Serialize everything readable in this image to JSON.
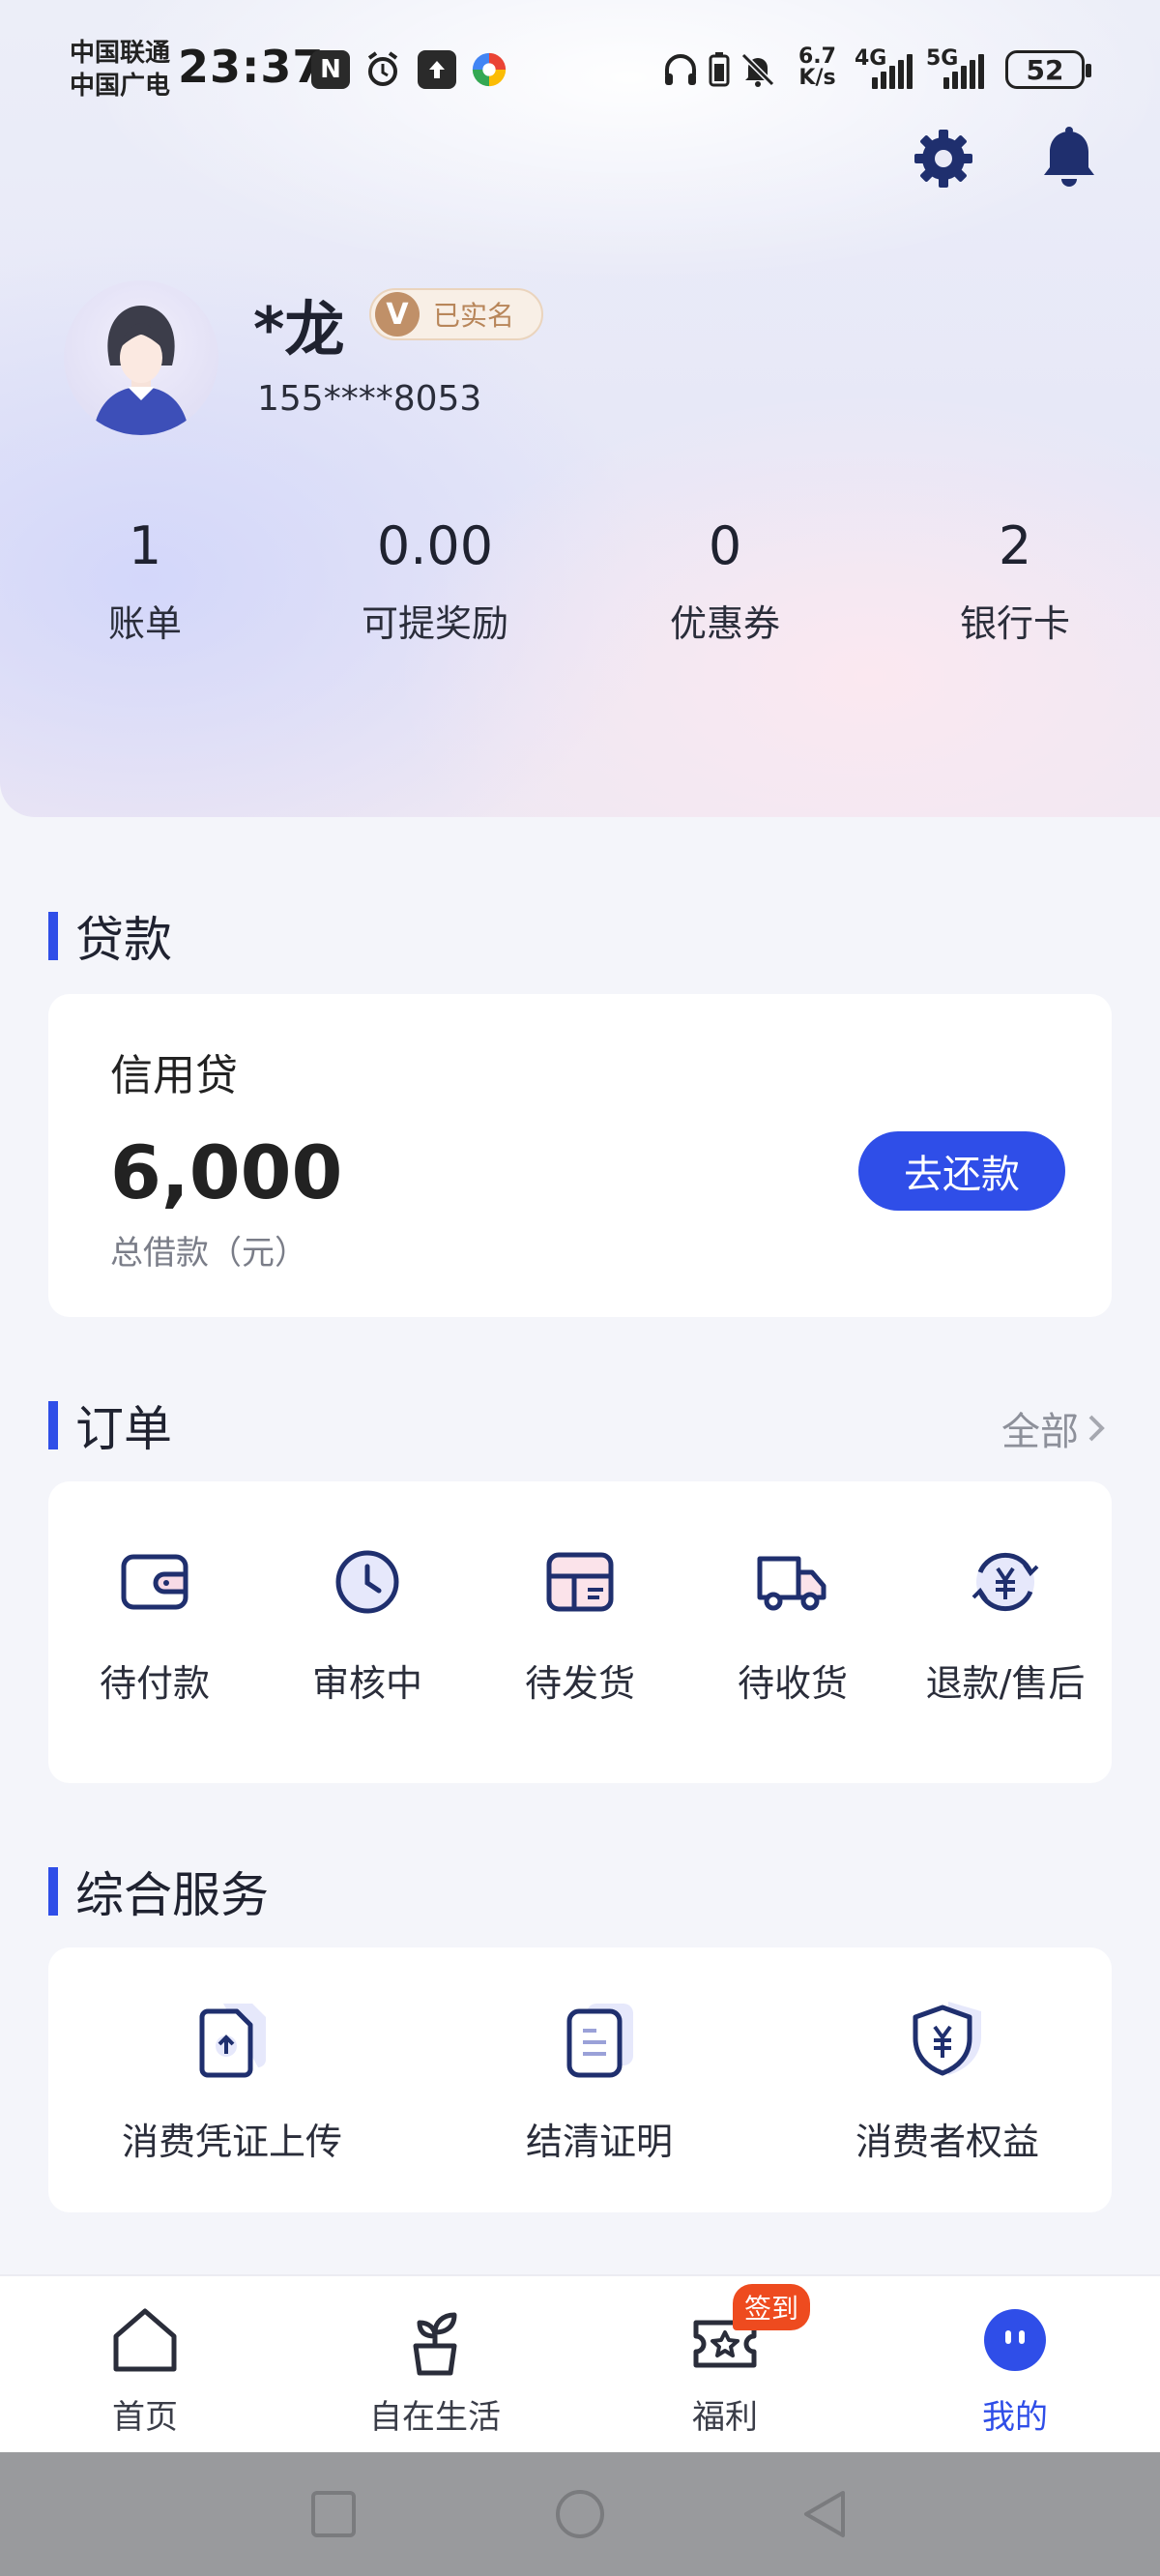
{
  "status_bar": {
    "carrier_1": "中国联通",
    "carrier_2": "中国广电",
    "time": "23:37",
    "net_speed_top": "6.7",
    "net_speed_bottom": "K/s",
    "sim1": "4G",
    "sim2": "5G",
    "battery": "52"
  },
  "profile": {
    "name": "*龙",
    "verified_badge": "V",
    "verified_label": "已实名",
    "phone": "155****8053"
  },
  "stats": [
    {
      "value": "1",
      "label": "账单"
    },
    {
      "value": "0.00",
      "label": "可提奖励"
    },
    {
      "value": "0",
      "label": "优惠券"
    },
    {
      "value": "2",
      "label": "银行卡"
    }
  ],
  "loan_section": {
    "title": "贷款",
    "product": "信用贷",
    "amount": "6,000",
    "amount_label": "总借款（元）",
    "repay_button": "去还款"
  },
  "order_section": {
    "title": "订单",
    "all_link": "全部",
    "items": [
      {
        "label": "待付款",
        "icon": "wallet-icon"
      },
      {
        "label": "审核中",
        "icon": "clock-icon"
      },
      {
        "label": "待发货",
        "icon": "package-icon"
      },
      {
        "label": "待收货",
        "icon": "truck-icon"
      },
      {
        "label": "退款/售后",
        "icon": "refund-icon"
      }
    ]
  },
  "service_section": {
    "title": "综合服务",
    "items": [
      {
        "label": "消费凭证上传",
        "icon": "upload-document-icon"
      },
      {
        "label": "结清证明",
        "icon": "document-icon"
      },
      {
        "label": "消费者权益",
        "icon": "shield-yen-icon"
      }
    ]
  },
  "tabbar": {
    "items": [
      {
        "label": "首页",
        "icon": "home-icon"
      },
      {
        "label": "自在生活",
        "icon": "plant-icon"
      },
      {
        "label": "福利",
        "icon": "gift-ticket-icon",
        "badge": "签到"
      },
      {
        "label": "我的",
        "icon": "face-icon",
        "active": true
      }
    ]
  },
  "colors": {
    "accent": "#2f4ee8",
    "badge": "#ee4b1f",
    "verified_gold": "#c09068"
  }
}
